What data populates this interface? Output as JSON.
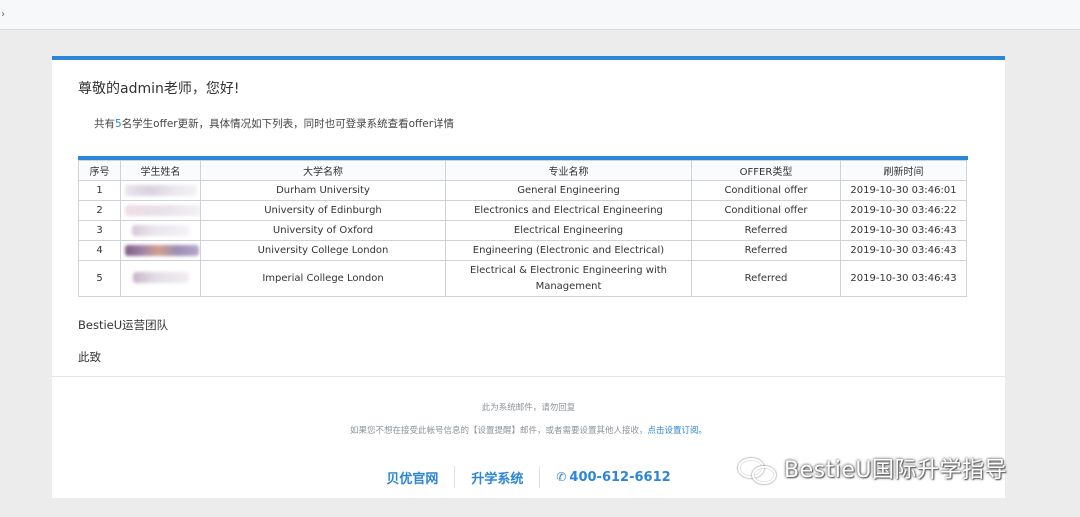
{
  "browser": {
    "caret": "›"
  },
  "email": {
    "greeting": "尊敬的admin老师，您好!",
    "summary_prefix": "共有",
    "summary_count": "5",
    "summary_suffix": "名学生offer更新，具体情况如下列表，同时也可登录系统查看offer详情",
    "table": {
      "headers": [
        "序号",
        "学生姓名",
        "大学名称",
        "专业名称",
        "OFFER类型",
        "刷新时间"
      ],
      "rows": [
        {
          "no": "1",
          "university": "Durham University",
          "major": "General Engineering",
          "offer_type": "Conditional offer",
          "time": "2019-10-30 03:46:01"
        },
        {
          "no": "2",
          "university": "University of Edinburgh",
          "major": "Electronics and Electrical Engineering",
          "offer_type": "Conditional offer",
          "time": "2019-10-30 03:46:22"
        },
        {
          "no": "3",
          "university": "University of Oxford",
          "major": "Electrical Engineering",
          "offer_type": "Referred",
          "time": "2019-10-30 03:46:43"
        },
        {
          "no": "4",
          "university": "University College London",
          "major": "Engineering (Electronic and Electrical)",
          "offer_type": "Referred",
          "time": "2019-10-30 03:46:43"
        },
        {
          "no": "5",
          "university": "Imperial College London",
          "major": "Electrical & Electronic Engineering with Management",
          "offer_type": "Referred",
          "time": "2019-10-30 03:46:43"
        }
      ]
    },
    "team": "BestieU运营团队",
    "regards": "此致",
    "notice1": "此为系统邮件，请勿回复",
    "notice2_text": "如果您不想在接受此帐号信息的【设置提醒】邮件，或者需要设置其他人接收，",
    "notice2_link": "点击设置订阅。",
    "footer": {
      "link1": "贝优官网",
      "link2": "升学系统",
      "phone": "400-612-6612",
      "phone_icon": "phone-icon"
    }
  },
  "watermark": {
    "text": "BestieU国际升学指导",
    "icon": "wechat-icon"
  },
  "colors": {
    "accent": "#2b86d7",
    "background": "#ececec"
  }
}
